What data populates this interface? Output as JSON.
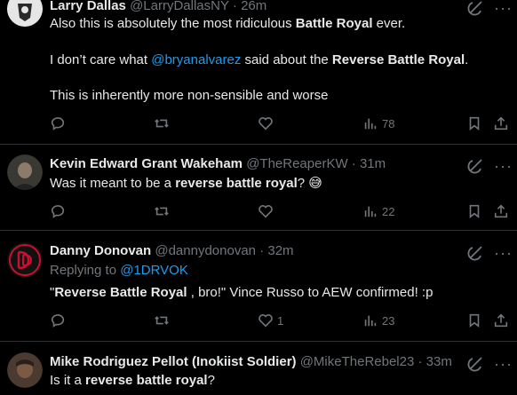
{
  "tweets": [
    {
      "name": "Larry Dallas",
      "handle": "@LarryDallasNY",
      "time": "26m",
      "lines": [
        {
          "parts": [
            {
              "t": "Also this is absolutely the most ridiculous "
            },
            {
              "t": "Battle Royal",
              "b": true
            },
            {
              "t": " ever."
            }
          ]
        },
        {
          "parts": [
            {
              "t": "I don’t care what "
            },
            {
              "t": "@bryanalvarez",
              "m": true
            },
            {
              "t": " said about the "
            },
            {
              "t": "Reverse Battle Royal",
              "b": true
            },
            {
              "t": "."
            }
          ]
        },
        {
          "parts": [
            {
              "t": "This is inherently more non-sensible and worse"
            }
          ]
        }
      ],
      "likes": "",
      "views": "78"
    },
    {
      "name": "Kevin Edward Grant Wakeham",
      "handle": "@TheReaperKW",
      "time": "31m",
      "lines": [
        {
          "parts": [
            {
              "t": "Was it meant to be a "
            },
            {
              "t": "reverse battle royal",
              "b": true
            },
            {
              "t": "? 😅"
            }
          ]
        }
      ],
      "likes": "",
      "views": "22"
    },
    {
      "name": "Danny Donovan",
      "handle": "@dannydonovan",
      "time": "32m",
      "replying_label": "Replying to",
      "replying_to": "@1DRVOK",
      "lines": [
        {
          "parts": [
            {
              "t": "\""
            },
            {
              "t": "Reverse Battle Royal",
              "b": true
            },
            {
              "t": " , bro!\" Vince Russo to AEW confirmed! :p"
            }
          ]
        }
      ],
      "likes": "1",
      "views": "23"
    },
    {
      "name": "Mike Rodriguez Pellot (Inokiist Soldier)",
      "handle": "@MikeTheRebel23",
      "time": "33m",
      "lines": [
        {
          "parts": [
            {
              "t": "Is it a "
            },
            {
              "t": "reverse battle royal",
              "b": true
            },
            {
              "t": "?"
            }
          ]
        }
      ]
    }
  ],
  "icons": {
    "reply": "reply-icon",
    "retweet": "retweet-icon",
    "like": "like-icon",
    "views": "views-icon",
    "bookmark": "bookmark-icon",
    "share": "share-icon",
    "grok": "grok-icon",
    "more": "more-icon"
  },
  "colors": {
    "background": "#000000",
    "text": "#e7e9ea",
    "muted": "#71767b",
    "link": "#1d9bf0",
    "divider": "#2f3336"
  }
}
